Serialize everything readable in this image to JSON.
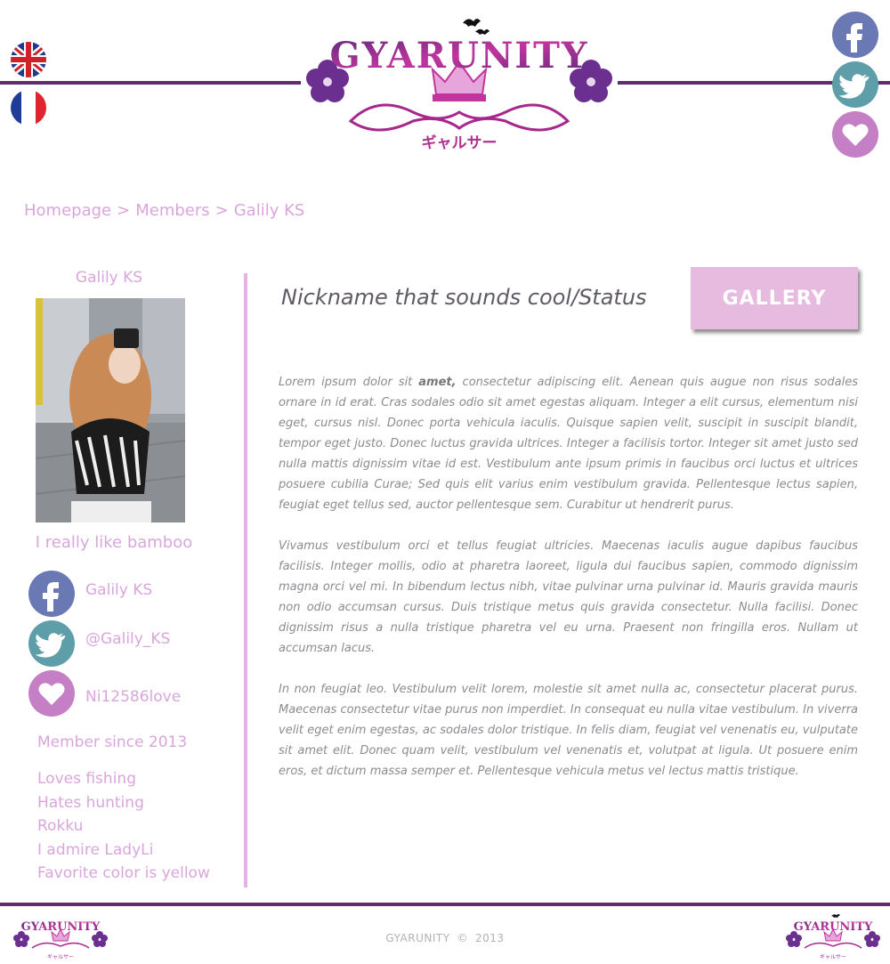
{
  "header": {
    "logo_text": "GYARUNITY",
    "logo_subtext": "ギャルサー",
    "languages": [
      {
        "name": "English",
        "icon": "uk-flag-icon"
      },
      {
        "name": "French",
        "icon": "france-flag-icon"
      }
    ],
    "social": [
      {
        "icon": "facebook-icon"
      },
      {
        "icon": "twitter-icon"
      },
      {
        "icon": "heart-icon"
      }
    ]
  },
  "breadcrumb": {
    "items": [
      "Homepage",
      "Members",
      "Galily KS"
    ],
    "separator": ">"
  },
  "sidebar": {
    "name": "Galily KS",
    "tagline": "I really like bamboo",
    "social": [
      {
        "icon": "facebook-icon",
        "label": "Galily KS"
      },
      {
        "icon": "twitter-icon",
        "label": "@Galily_KS"
      },
      {
        "icon": "heart-icon",
        "label": "Ni12586love"
      }
    ],
    "member_since": "Member since 2013",
    "facts": [
      "Loves fishing",
      "Hates hunting",
      "Rokku",
      "I admire LadyLi",
      "Favorite color is yellow"
    ]
  },
  "main": {
    "title": "Nickname that sounds cool/Status",
    "gallery_label": "GALLERY",
    "paragraphs": [
      {
        "pre": "Lorem ipsum dolor sit ",
        "bold": "amet,",
        "post": " consectetur adipiscing elit. Aenean quis augue non risus sodales ornare in id erat. Cras sodales odio sit amet egestas aliquam. Integer a elit cursus, elementum nisi eget, cursus nisl. Donec porta vehicula iaculis. Quisque sapien velit, suscipit in suscipit blandit, tempor eget justo. Donec luctus gravida ultrices. Integer a facilisis tortor. Integer sit amet justo sed nulla mattis dignissim vitae id est. Vestibulum ante ipsum primis in faucibus orci luctus et ultrices posuere cubilia Curae; Sed quis elit varius enim vestibulum gravida. Pellentesque lectus sapien, feugiat eget tellus sed, auctor pellentesque sem. Curabitur ut hendrerit purus."
      },
      "Vivamus vestibulum orci et tellus feugiat ultricies. Maecenas iaculis augue dapibus faucibus facilisis. Integer mollis, odio at pharetra laoreet, ligula dui faucibus sapien, commodo dignissim magna orci vel mi. In bibendum lectus nibh, vitae pulvinar urna pulvinar id. Mauris gravida mauris non odio accumsan cursus. Duis tristique metus quis gravida consectetur. Nulla facilisi. Donec dignissim risus a nulla tristique pharetra vel eu urna. Praesent non fringilla eros. Nullam ut accumsan lacus.",
      "In non feugiat leo. Vestibulum velit lorem, molestie sit amet nulla ac, consectetur placerat purus. Maecenas consectetur vitae purus non imperdiet. In consequat eu nulla vitae vestibulum. In viverra velit eget enim egestas, ac sodales dolor tristique. In felis diam, feugiat vel venenatis eu, vulputate sit amet elit. Donec quam velit, vestibulum vel venenatis et, volutpat at ligula. Ut posuere enim eros, et dictum massa semper et. Pellentesque vehicula metus vel lectus mattis tristique."
    ]
  },
  "footer": {
    "brand": "GYARUNITY",
    "copyright_glyph": "©",
    "year": "2013"
  },
  "colors": {
    "accent_pink": "#d9a6dc",
    "bar_purple": "#5e2d6b",
    "facebook": "#6a78b3",
    "twitter": "#5e9ea9",
    "heart": "#c57fc4",
    "gallery_button": "#e7badf"
  }
}
